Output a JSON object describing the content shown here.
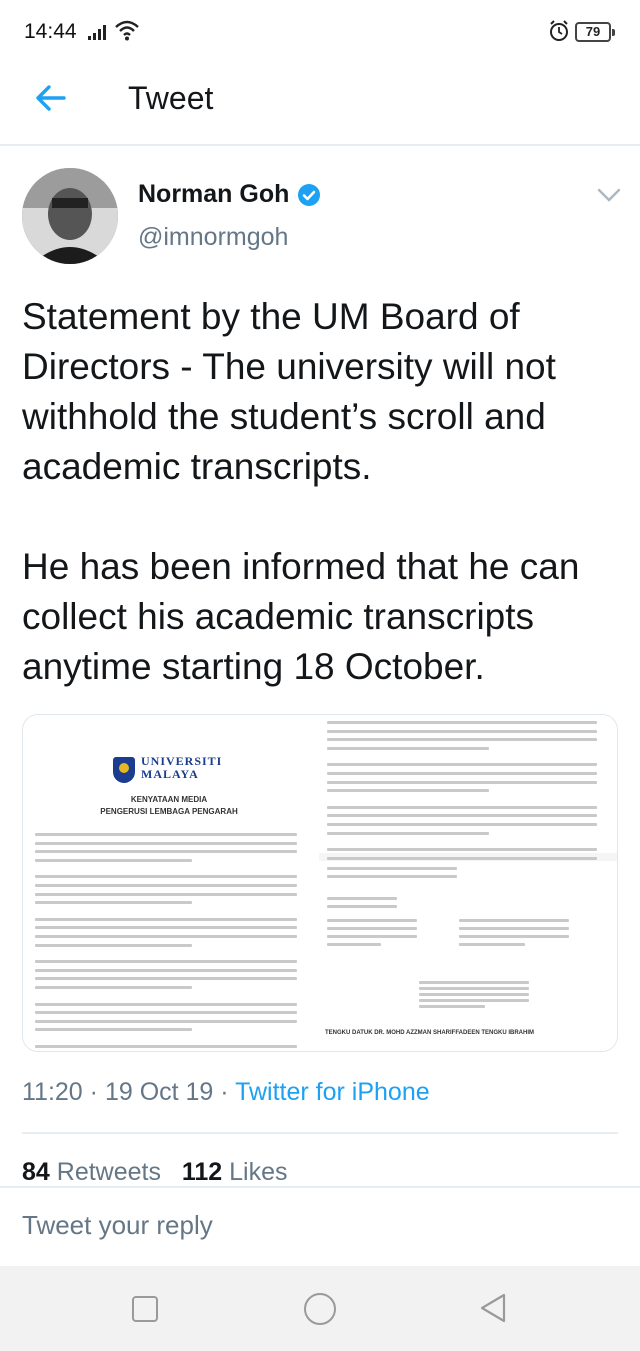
{
  "status_bar": {
    "time": "14:44",
    "battery": "79"
  },
  "header": {
    "title": "Tweet"
  },
  "author": {
    "name": "Norman Goh",
    "handle": "@imnormgoh",
    "verified": true
  },
  "tweet": {
    "text": "Statement by the UM Board of Directors - The university will not withhold the student’s scroll and academic transcripts.\n\nHe has been informed that he can collect his academic transcripts anytime starting 18 October."
  },
  "media": {
    "doc_left": {
      "logo_text": "UNIVERSITI\nMALAYA",
      "heading_1": "KENYATAAN MEDIA",
      "heading_2": "PENGERUSI LEMBAGA PENGARAH"
    },
    "doc_right": {
      "signatory": "TENGKU DATUK DR. MOHD AZZMAN SHARIFFADEEN TENGKU IBRAHIM"
    }
  },
  "meta": {
    "time": "11:20",
    "date": "19 Oct 19",
    "source": "Twitter for iPhone"
  },
  "stats": {
    "retweets_count": "84",
    "retweets_label": "Retweets",
    "likes_count": "112",
    "likes_label": "Likes"
  },
  "reply": {
    "placeholder": "Tweet your reply"
  },
  "colors": {
    "accent": "#1da1f2",
    "muted": "#657786",
    "text": "#14171a",
    "border": "#e6ecf0"
  },
  "icons": {
    "back": "arrow-left-icon",
    "verified": "verified-badge-icon",
    "more": "chevron-down-icon"
  }
}
